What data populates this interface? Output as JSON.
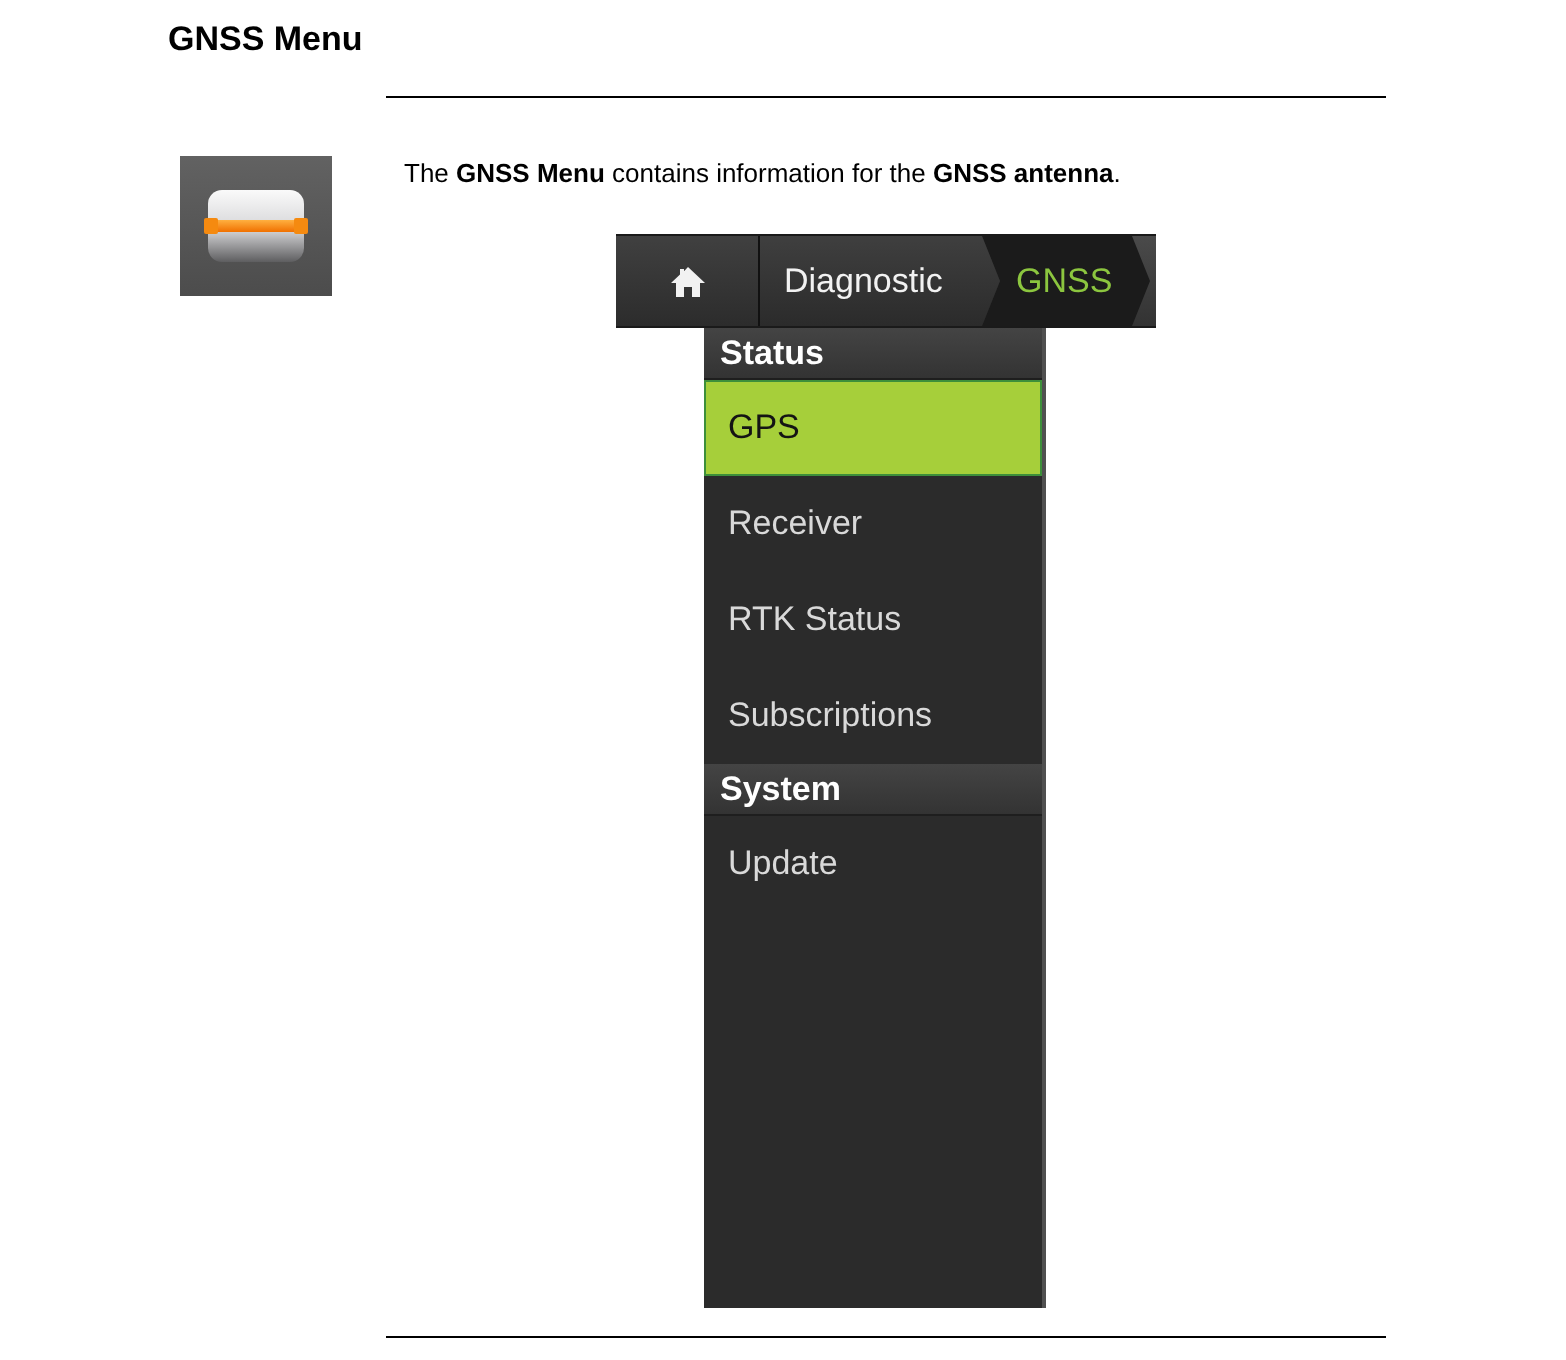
{
  "heading": "GNSS Menu",
  "intro": "The **GNSS Menu** contains information for the **GNSS antenna**.",
  "device": {
    "breadcrumb": [
      {
        "kind": "home",
        "selected": false
      },
      {
        "kind": "crumb",
        "label": "Diagnostic",
        "selected": false
      },
      {
        "kind": "crumb",
        "label": "GNSS",
        "selected": true
      }
    ],
    "menu": [
      {
        "kind": "header",
        "label": "Status"
      },
      {
        "kind": "item",
        "label": "GPS",
        "selected": true
      },
      {
        "kind": "item",
        "label": "Receiver",
        "selected": false
      },
      {
        "kind": "item",
        "label": "RTK Status",
        "selected": false
      },
      {
        "kind": "item",
        "label": "Subscriptions",
        "selected": false
      },
      {
        "kind": "header",
        "label": "System"
      },
      {
        "kind": "item",
        "label": "Update",
        "selected": false
      }
    ]
  }
}
